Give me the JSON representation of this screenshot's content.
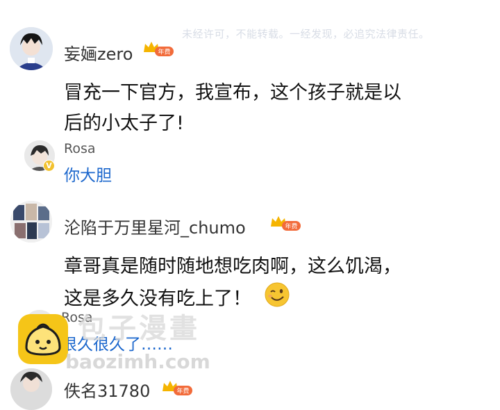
{
  "watermark": {
    "notice": "未经许可，不能转载。一经发现，必追究法律责任。",
    "site_title": "包子漫畫",
    "site_url": "baozimh.com"
  },
  "comments": [
    {
      "username": "妄婳zero",
      "badge": "年费",
      "text_line1": "冒充一下官方，我宣布，这个孩子就是以",
      "text_line2": "后的小太子了!",
      "reply": {
        "username": "Rosa",
        "text": "你大胆",
        "verified_mark": "V"
      }
    },
    {
      "username": "沦陷于万里星河_chumo",
      "badge": "年费",
      "text_line1": "章哥真是随时随地想吃肉啊，这么饥渴，",
      "text_line2": "这是多久没有吃上了！",
      "emoji": "wink-emoji",
      "reply": {
        "username": "Rosa",
        "text": "很久很久了……"
      }
    },
    {
      "username": "佚名31780",
      "badge": "年费"
    }
  ],
  "colors": {
    "crown": "#f5b400",
    "badge": "#f26b3a",
    "reply_link": "#1a66cc",
    "watermark_logo": "#f5c518"
  }
}
